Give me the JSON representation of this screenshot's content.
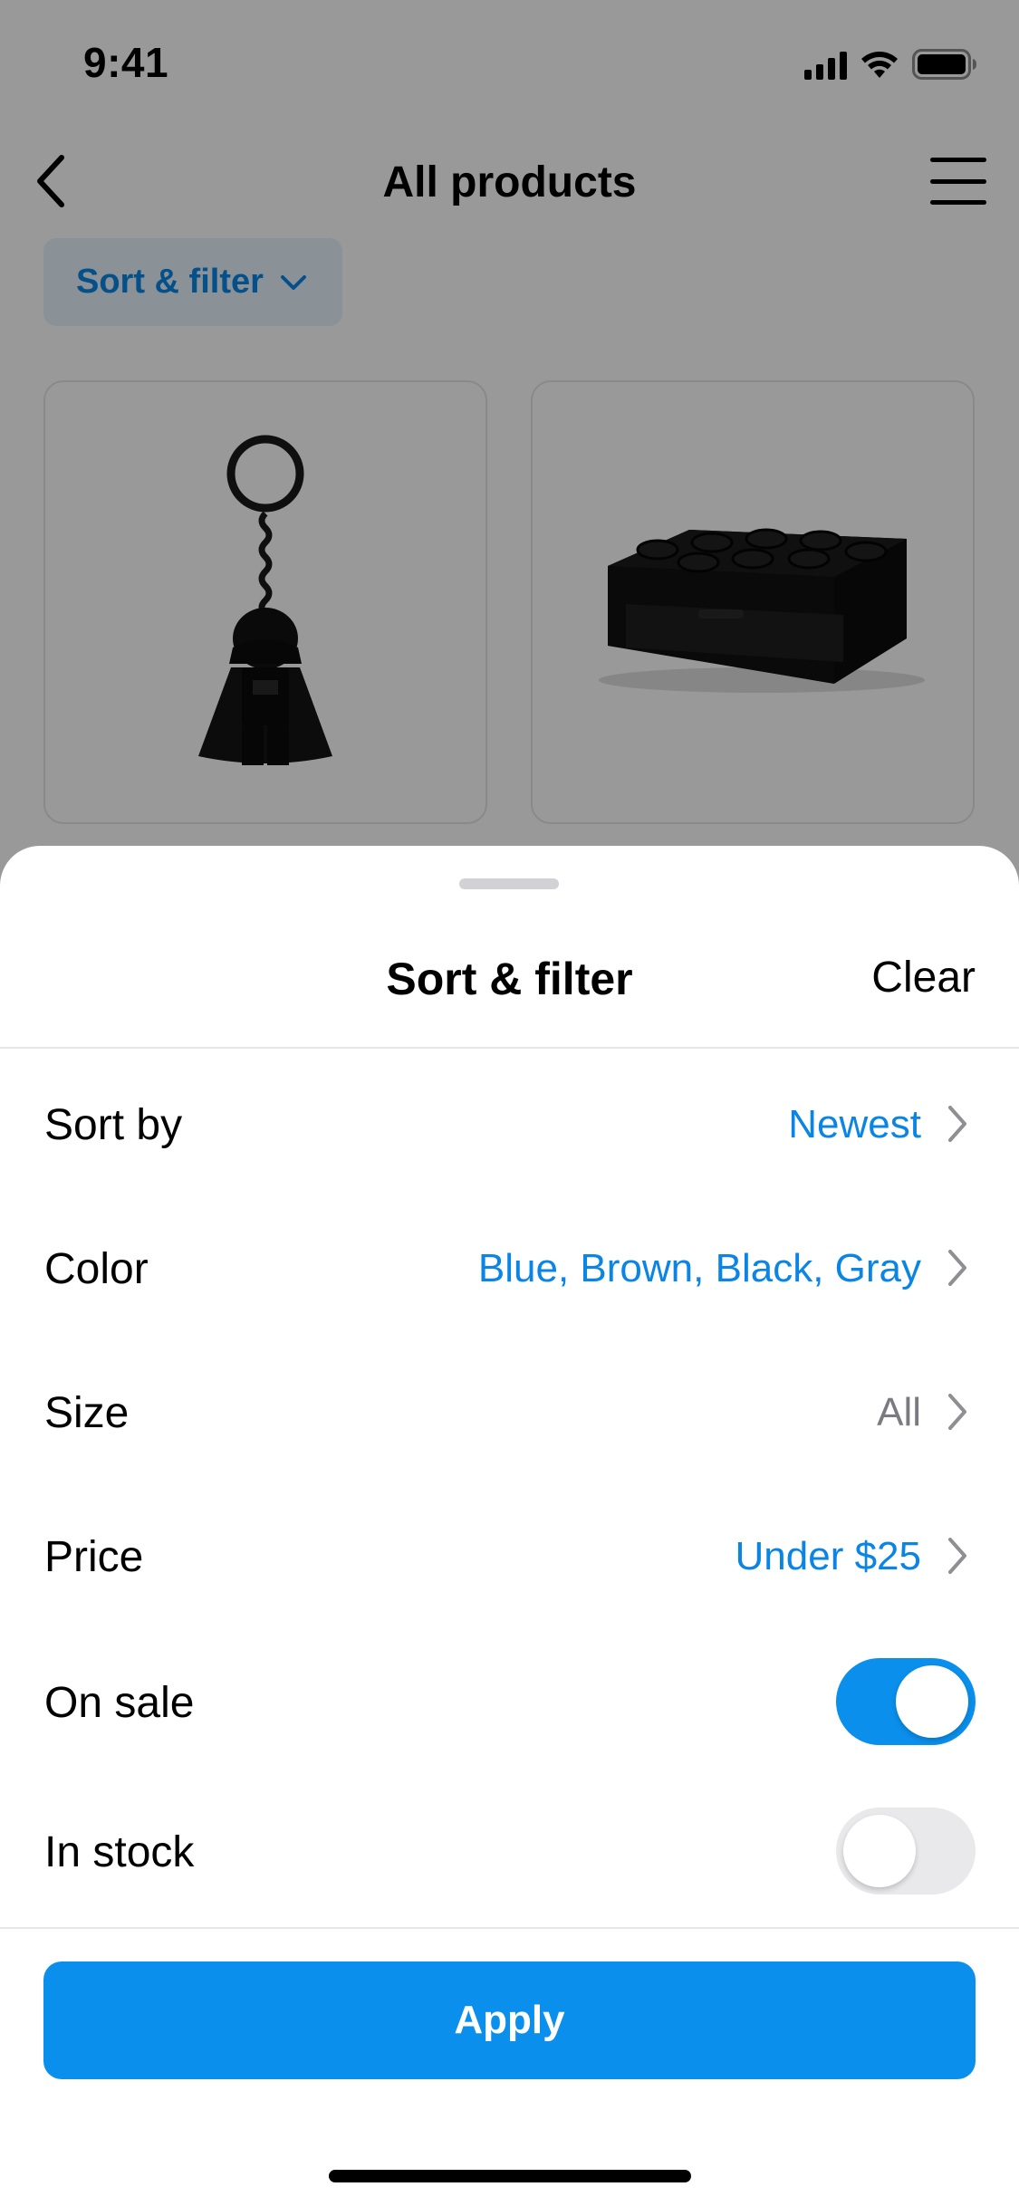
{
  "status_bar": {
    "time": "9:41",
    "icons": [
      "cellular-signal-icon",
      "wifi-icon",
      "battery-icon"
    ]
  },
  "nav": {
    "title": "All products",
    "back_icon": "chevron-left-icon",
    "menu_icon": "hamburger-menu-icon"
  },
  "filter_chip": {
    "label": "Sort & filter",
    "icon": "chevron-down-icon"
  },
  "products": [
    {
      "image": "darth-vader-keychain-image"
    },
    {
      "image": "black-brick-storage-drawer-image"
    }
  ],
  "sheet": {
    "title": "Sort & filter",
    "clear_label": "Clear",
    "rows": [
      {
        "label": "Sort by",
        "value": "Newest",
        "active": true
      },
      {
        "label": "Color",
        "value": "Blue, Brown, Black, Gray",
        "active": true
      },
      {
        "label": "Size",
        "value": "All",
        "active": false
      },
      {
        "label": "Price",
        "value": "Under $25",
        "active": true
      }
    ],
    "toggles": [
      {
        "label": "On sale",
        "on": true
      },
      {
        "label": "In stock",
        "on": false
      }
    ],
    "apply_label": "Apply"
  },
  "colors": {
    "accent": "#0A8FEC",
    "chip_background": "#E6F3FD",
    "muted_text": "#7A7A80",
    "divider": "#E5E5EA",
    "toggle_off": "#E9E9EB"
  }
}
